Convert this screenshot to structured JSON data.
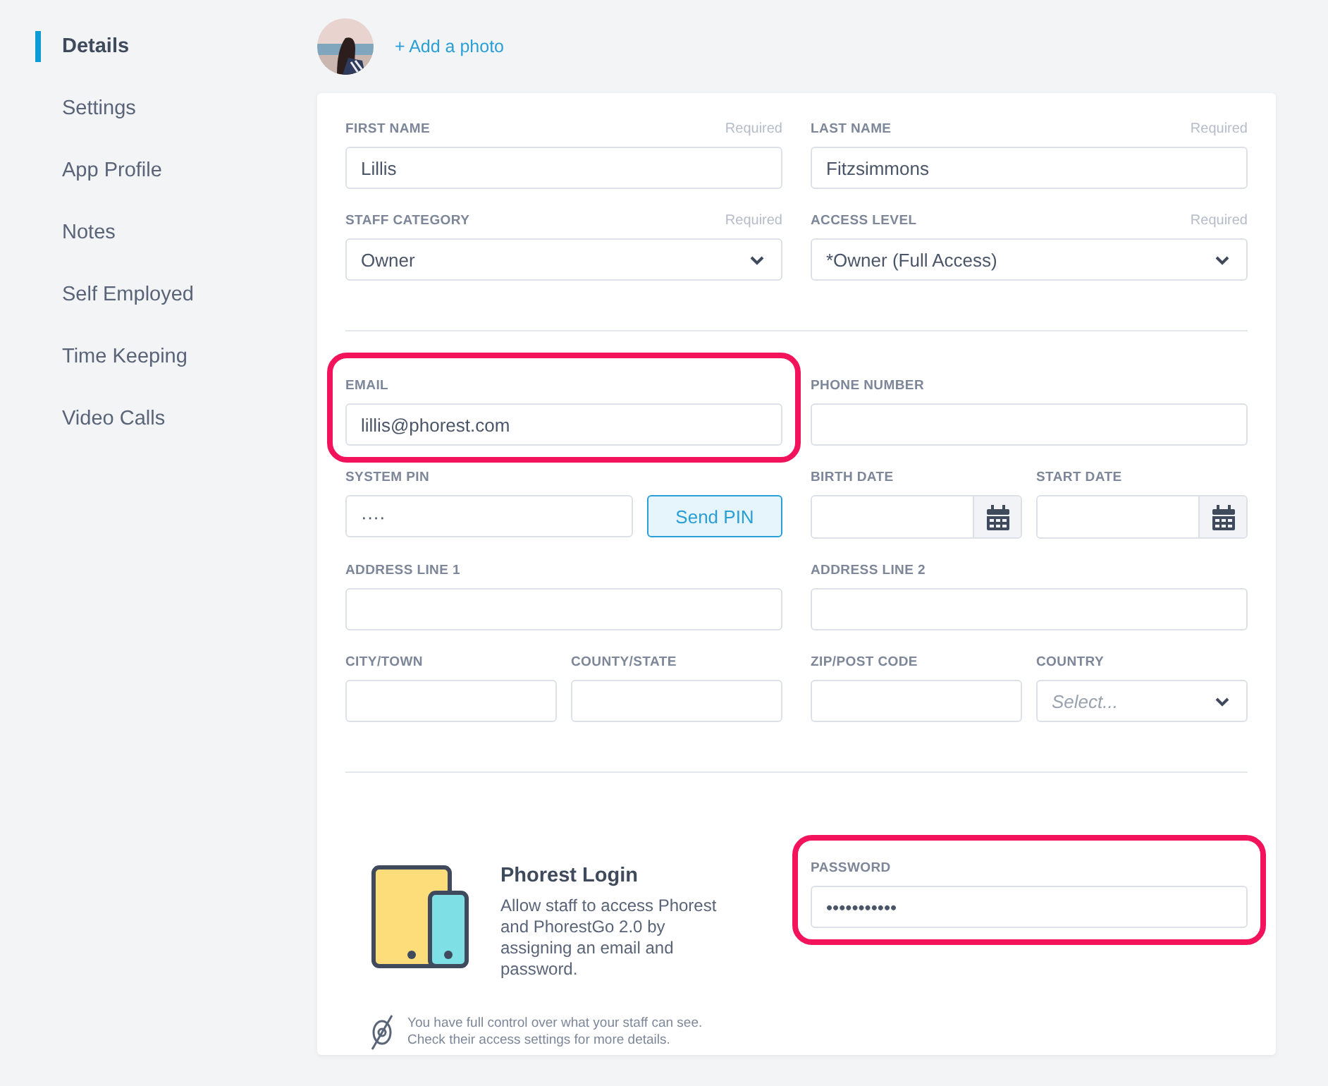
{
  "sidebar": {
    "items": [
      {
        "label": "Details",
        "selected": true
      },
      {
        "label": "Settings",
        "selected": false
      },
      {
        "label": "App Profile",
        "selected": false
      },
      {
        "label": "Notes",
        "selected": false
      },
      {
        "label": "Self Employed",
        "selected": false
      },
      {
        "label": "Time Keeping",
        "selected": false
      },
      {
        "label": "Video Calls",
        "selected": false
      }
    ]
  },
  "photo": {
    "kind": "picture",
    "link": "+ Add a photo"
  },
  "sections": [
    {
      "rows": [
        {
          "left": [
            {
              "label": "FIRST NAME",
              "note": "Required",
              "kind": "text",
              "value": "Lillis"
            }
          ],
          "right": [
            {
              "label": "LAST NAME",
              "note": "Required",
              "kind": "text",
              "value": "Fitzsimmons"
            }
          ]
        },
        {
          "left": [
            {
              "label": "STAFF CATEGORY",
              "note": "Required",
              "kind": "select",
              "value": "Owner"
            }
          ],
          "right": [
            {
              "label": "ACCESS LEVEL",
              "note": "Required",
              "kind": "select",
              "value": "*Owner (Full Access)"
            }
          ]
        }
      ]
    },
    {
      "rows": [
        {
          "left": [
            {
              "label": "EMAIL",
              "kind": "text",
              "value": "lillis@phorest.com",
              "highlighted": true
            }
          ],
          "right": [
            {
              "label": "PHONE NUMBER",
              "kind": "text"
            }
          ]
        },
        {
          "left": [
            {
              "label": "SYSTEM PIN",
              "kind": "pin",
              "value": "····",
              "button": "Send PIN"
            }
          ],
          "right": [
            {
              "label": "BIRTH DATE",
              "kind": "date"
            },
            {
              "label": "START DATE",
              "kind": "date"
            }
          ]
        },
        {
          "left": [
            {
              "label": "ADDRESS LINE 1",
              "kind": "text"
            }
          ],
          "right": [
            {
              "label": "ADDRESS LINE 2",
              "kind": "text"
            }
          ]
        },
        {
          "left": [
            {
              "label": "CITY/TOWN",
              "kind": "text"
            },
            {
              "label": "COUNTY/STATE",
              "kind": "text"
            }
          ],
          "right": [
            {
              "label": "ZIP/POST CODE",
              "kind": "text"
            },
            {
              "label": "COUNTRY",
              "kind": "select",
              "placeholder": "Select..."
            }
          ]
        }
      ]
    }
  ],
  "login": {
    "title": "Phorest Login",
    "description": "Allow staff to access Phorest and PhorestGo 2.0 by assigning an email and password.",
    "password": {
      "label": "PASSWORD",
      "kind": "text",
      "value": "•••••••••••",
      "highlighted": true
    },
    "note": "You have full control over what your staff can see. Check their access settings for more details."
  }
}
